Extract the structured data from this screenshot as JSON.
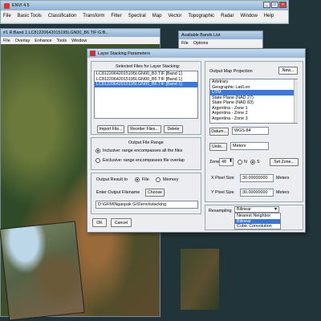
{
  "envi": {
    "title": "ENVI 4.5",
    "menu": [
      "File",
      "Basic Tools",
      "Classification",
      "Transform",
      "Filter",
      "Spectral",
      "Map",
      "Vector",
      "Topographic",
      "Radar",
      "Window",
      "Help"
    ]
  },
  "image_window": {
    "title": "#1 R:Band 1:LC81220642015195LGN00_B6.TIF:G:B...",
    "menu": [
      "File",
      "Overlay",
      "Enhance",
      "Tools",
      "Window"
    ]
  },
  "bands_list": {
    "title": "Available Bands List",
    "menu": [
      "File",
      "Options"
    ]
  },
  "dialog": {
    "title": "Layer Stacking Parameters",
    "selected_files_label": "Selected Files for Layer Stacking:",
    "files": [
      "LC81220642015195LGN00_B3.TIF [Band 1]",
      "LC81220642015195LGN00_B5.TIF [Band 1]",
      "LC81220642015195LGN00_B6.TIF [Band 1]"
    ],
    "import_label": "Import File...",
    "reorder_label": "Reorder Files...",
    "delete_label": "Delete",
    "range_label": "Output File Range",
    "inclusive_label": "Inclusive: range encompasses all the files",
    "exclusive_label": "Exclusive: range encompasses file overlap",
    "output_result_label": "Output Result to",
    "file_label": "File",
    "memory_label": "Memory",
    "enter_filename_label": "Enter Output Filename",
    "choose_label": "Choose",
    "filename_value": "D:\\GFM\\Ngaspak GIS\\envi\\stacking",
    "ok_label": "OK",
    "cancel_label": "Cancel",
    "projection_label": "Output Map Projection",
    "new_label": "New...",
    "projections": [
      "Arbitrary",
      "Geographic Lat/Lon",
      "UTM",
      "State Plane (NAD 27)",
      "State Plane (NAD 83)",
      "Argentina - Zone 1",
      "Argentina - Zone 2",
      "Argentina - Zone 3"
    ],
    "selected_projection": "UTM",
    "datum_label": "Datum...",
    "datum_value": "WGS-84",
    "units_label": "Units...",
    "units_value": "Meters",
    "zone_label": "Zone",
    "zone_value": "48",
    "n_label": "N",
    "s_label": "S",
    "set_zone_label": "Set Zone...",
    "xpixel_label": "X Pixel Size",
    "xpixel_value": "30.00000000",
    "ypixel_label": "Y Pixel Size",
    "ypixel_value": "30.00000000",
    "meters_label": "Meters",
    "resampling_label": "Resampling",
    "resampling_value": "Bilinear",
    "resampling_options": [
      "Nearest Neighbor",
      "Bilinear",
      "Cubic Convolution"
    ]
  },
  "colors": {
    "selection": "#3c78d8",
    "titlebar": "#9ab9d8"
  }
}
